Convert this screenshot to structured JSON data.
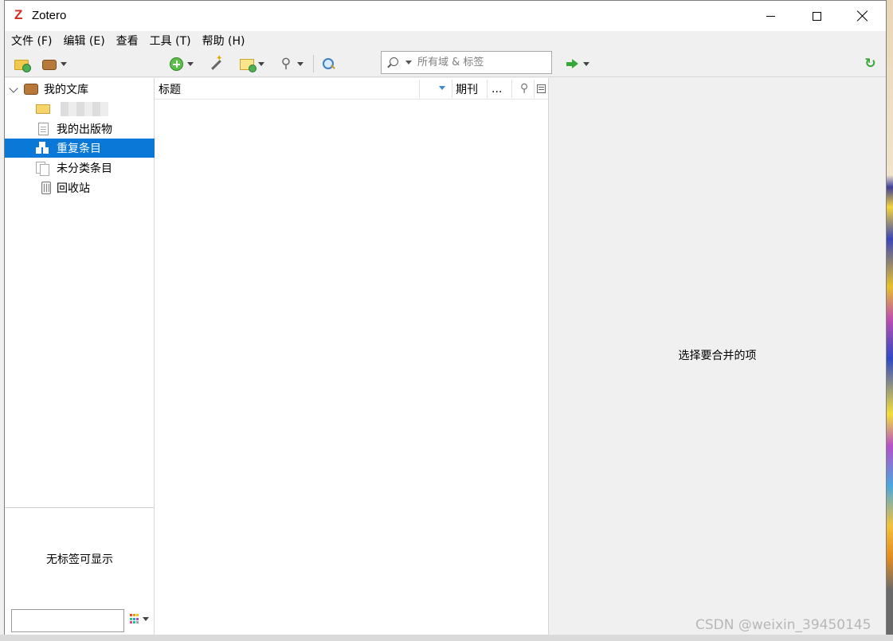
{
  "window": {
    "title": "Zotero",
    "logo_letter": "Z",
    "controls": {
      "minimize": "minimize",
      "maximize": "maximize",
      "close": "close"
    }
  },
  "menubar": {
    "items": [
      "文件 (F)",
      "编辑 (E)",
      "查看",
      "工具 (T)",
      "帮助 (H)"
    ]
  },
  "toolbar": {
    "search": {
      "placeholder": "所有域 & 标签",
      "value": ""
    },
    "icons": [
      "new-collection-icon",
      "new-library-icon",
      "new-item-icon",
      "add-by-identifier-icon",
      "new-note-icon",
      "add-attachment-icon",
      "advanced-search-icon",
      "locate-icon",
      "sync-icon"
    ]
  },
  "collections": {
    "library": "我的文库",
    "items": [
      {
        "label": "",
        "icon": "folder-icon"
      },
      {
        "label": "我的出版物",
        "icon": "publications-icon"
      },
      {
        "label": "重复条目",
        "icon": "duplicates-icon",
        "selected": true
      },
      {
        "label": "未分类条目",
        "icon": "unfiled-icon"
      },
      {
        "label": "回收站",
        "icon": "trash-icon"
      }
    ]
  },
  "tag_selector": {
    "empty_message": "无标签可显示",
    "filter_value": ""
  },
  "items_pane": {
    "columns": {
      "title": "标题",
      "journal": "期刊",
      "more": "..."
    },
    "rows": []
  },
  "item_pane": {
    "message": "选择要合并的项"
  },
  "watermark": "CSDN @weixin_39450145",
  "colors": {
    "selection": "#0a78d7",
    "logo": "#d32a1f",
    "accent_green": "#3aa63a"
  }
}
